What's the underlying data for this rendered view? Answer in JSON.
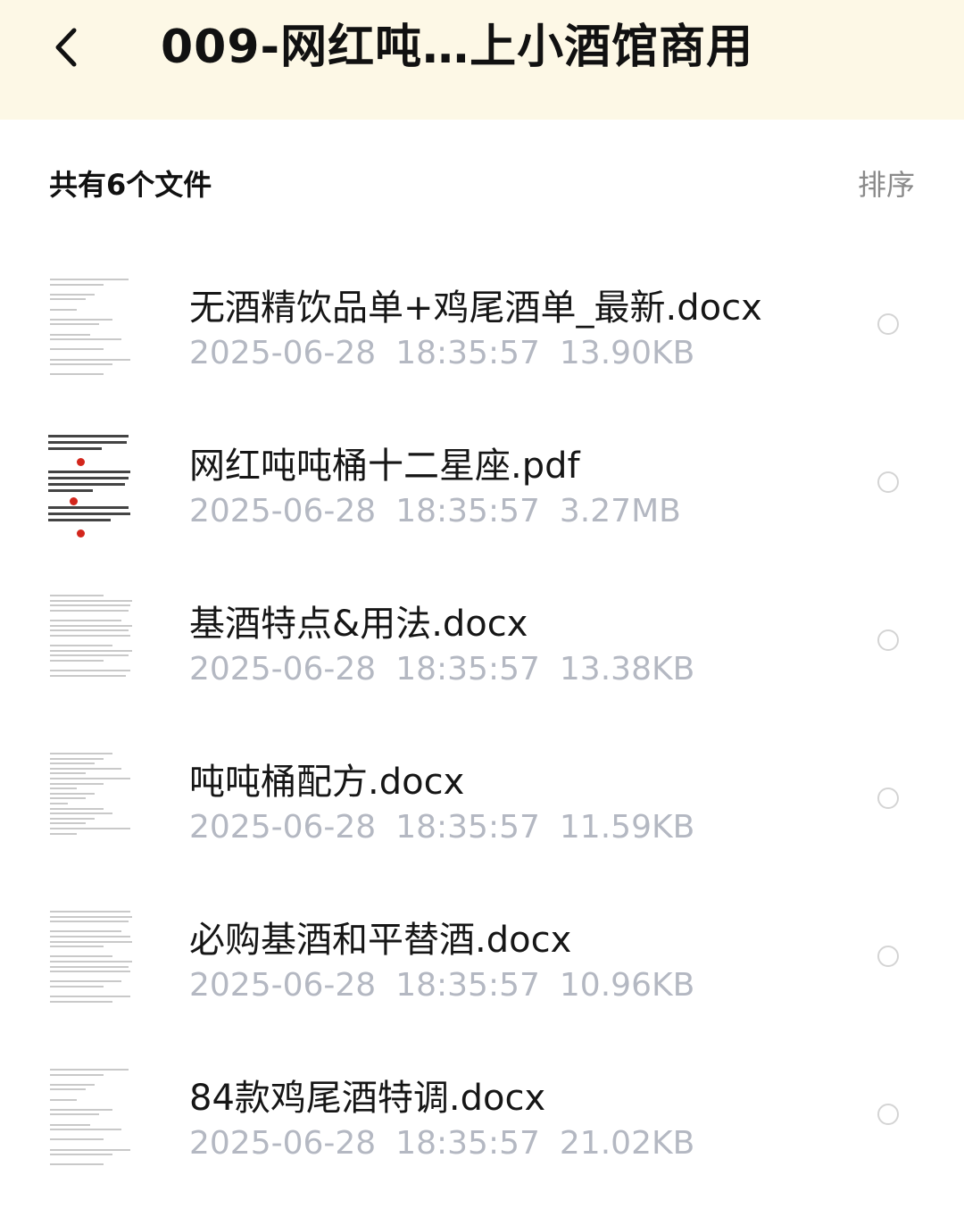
{
  "header": {
    "title": "009-网红吨…上小酒馆商用",
    "back_icon": "chevron-left-icon"
  },
  "summary": {
    "count_text": "共有6个文件",
    "sort_label": "排序"
  },
  "files": [
    {
      "name": "无酒精饮品单+鸡尾酒单_最新.docx",
      "date": "2025-06-28",
      "time": "18:35:57",
      "size": "13.90KB",
      "thumb_type": "doc"
    },
    {
      "name": "网红吨吨桶十二星座.pdf",
      "date": "2025-06-28",
      "time": "18:35:57",
      "size": "3.27MB",
      "thumb_type": "pdf"
    },
    {
      "name": "基酒特点&用法.docx",
      "date": "2025-06-28",
      "time": "18:35:57",
      "size": "13.38KB",
      "thumb_type": "doc"
    },
    {
      "name": "吨吨桶配方.docx",
      "date": "2025-06-28",
      "time": "18:35:57",
      "size": "11.59KB",
      "thumb_type": "doc"
    },
    {
      "name": "必购基酒和平替酒.docx",
      "date": "2025-06-28",
      "time": "18:35:57",
      "size": "10.96KB",
      "thumb_type": "doc"
    },
    {
      "name": "84款鸡尾酒特调.docx",
      "date": "2025-06-28",
      "time": "18:35:57",
      "size": "21.02KB",
      "thumb_type": "doc"
    }
  ],
  "colors": {
    "header_bg": "#fdf8e6",
    "meta_text": "#b4b8c2",
    "sort_text": "#8a8a8a"
  }
}
